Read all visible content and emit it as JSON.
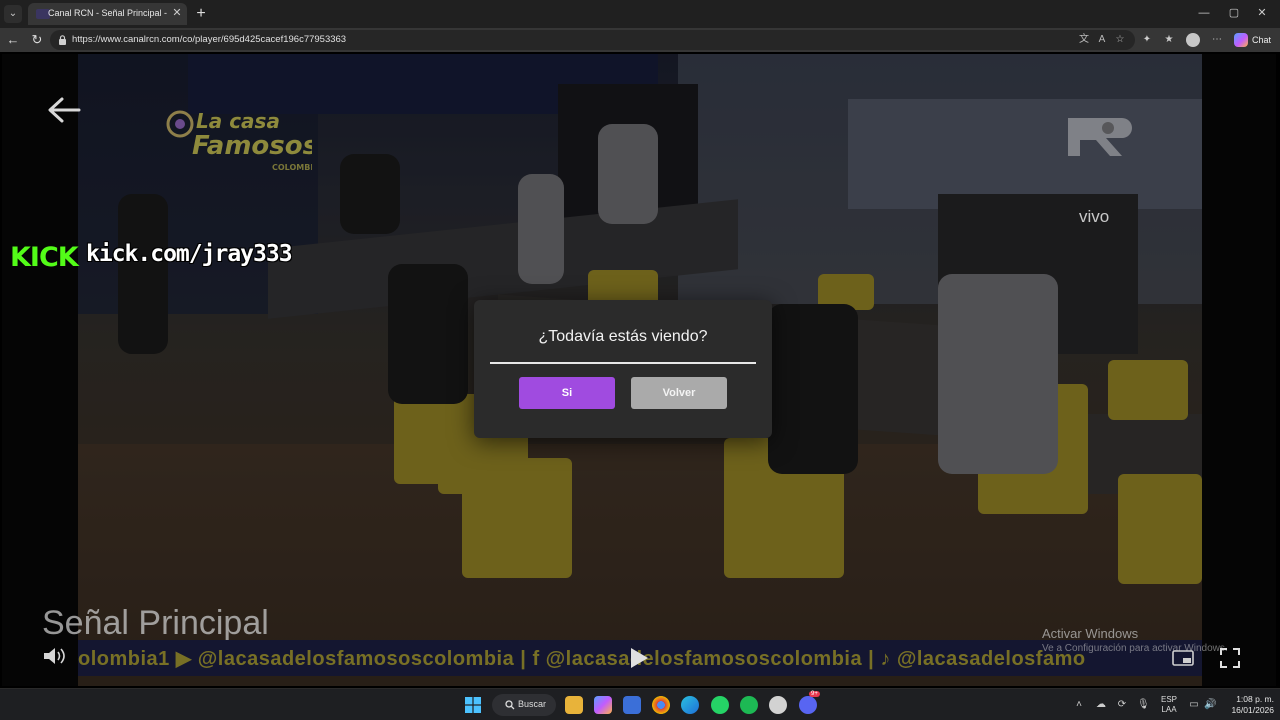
{
  "browser": {
    "tab_title": "Canal RCN - Señal Principal - mart",
    "url": "https://www.canalrcn.com/co/player/695d425cacef196c77953363",
    "chat_label": "Chat",
    "window_controls": {
      "minimize": "—",
      "maximize": "▢",
      "close": "✕"
    }
  },
  "player": {
    "watermark_url": "kick.com/jray333",
    "kick_logo_text": "KICK",
    "channel_title": "Señal Principal",
    "network_badge": "vivo",
    "show_logo_text": "La casa de los Famosos COLOMBIA",
    "ticker_text": "olombia1  ▶ @lacasadelosfamososcolombia  |  f @lacasadelosfamososcolombia  |  ♪ @lacasadelosfamo"
  },
  "dialog": {
    "title": "¿Todavía estás viendo?",
    "confirm_label": "Si",
    "back_label": "Volver"
  },
  "system": {
    "activate_title": "Activar Windows",
    "activate_subtitle": "Ve a Configuración para activar Windows.",
    "search_label": "Buscar",
    "lang_line1": "ESP",
    "lang_line2": "LAA",
    "time": "1:08 p. m.",
    "date": "16/01/2026",
    "discord_badge": "9+"
  },
  "colors": {
    "accent_purple": "#a04be0",
    "secondary_gray": "#aaaaaa",
    "kick_green": "#53fc18",
    "ticker_yellow": "#b8ac3a"
  }
}
